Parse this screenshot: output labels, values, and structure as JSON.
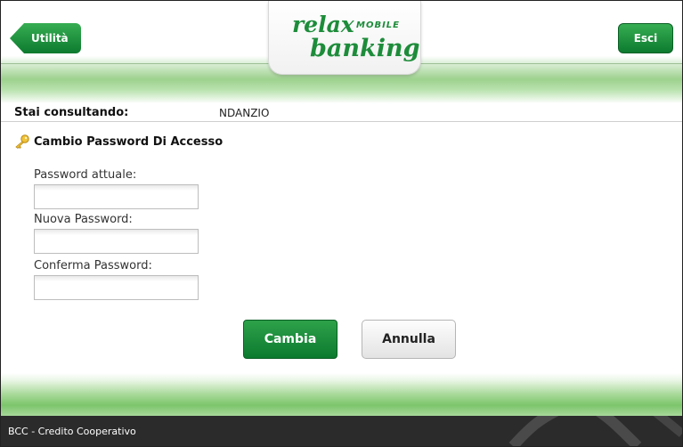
{
  "header": {
    "back_label": "Utilità",
    "exit_label": "Esci",
    "logo": {
      "word1": "relax",
      "word2": "MOBILE",
      "word3": "banking"
    }
  },
  "consult": {
    "label": "Stai consultando:",
    "value": "NDANZIO"
  },
  "section": {
    "title": "Cambio Password Di Accesso"
  },
  "form": {
    "current_label": "Password attuale:",
    "new_label": "Nuova Password:",
    "confirm_label": "Conferma Password:",
    "current_value": "",
    "new_value": "",
    "confirm_value": ""
  },
  "actions": {
    "submit_label": "Cambia",
    "cancel_label": "Annulla"
  },
  "footer": {
    "text": "BCC - Credito Cooperativo"
  },
  "colors": {
    "brand_green": "#1d8c3a",
    "button_green": "#0c7a2e",
    "footer_bg": "#2b2b2b"
  }
}
